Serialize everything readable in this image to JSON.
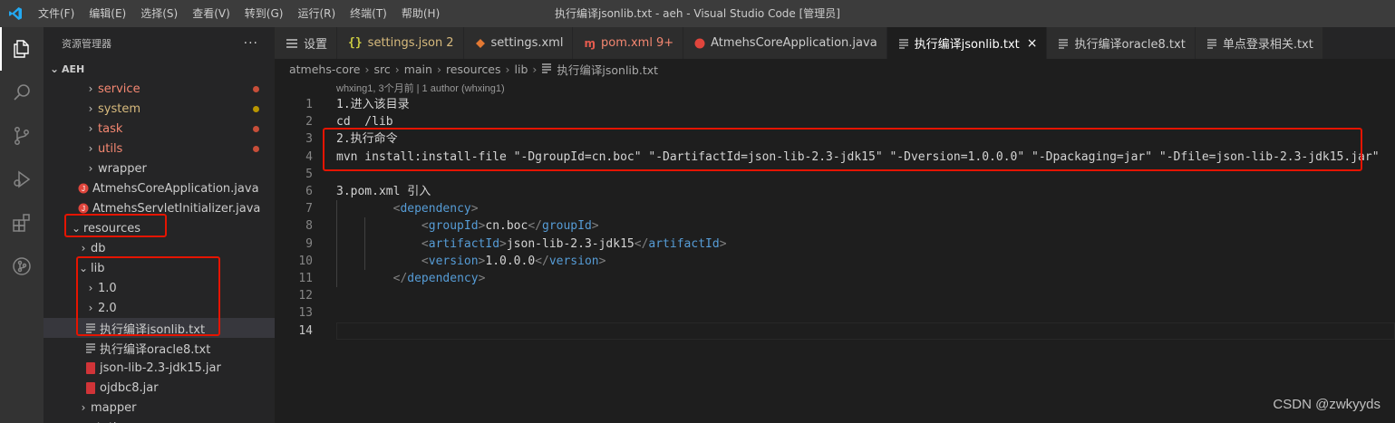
{
  "window": {
    "title": "执行编译jsonlib.txt - aeh - Visual Studio Code [管理员]",
    "menu": [
      "文件(F)",
      "编辑(E)",
      "选择(S)",
      "查看(V)",
      "转到(G)",
      "运行(R)",
      "终端(T)",
      "帮助(H)"
    ],
    "app_icon": "vscode-logo-icon"
  },
  "activity_bar": [
    "files-icon",
    "search-icon",
    "source-control-icon",
    "run-debug-icon",
    "extensions-icon",
    "git-graph-icon"
  ],
  "sidebar": {
    "title": "资源管理器",
    "more": "···",
    "root": "AEH",
    "items": [
      {
        "label": "service",
        "color": "#f48771",
        "dot": "#c74e39"
      },
      {
        "label": "system",
        "color": "#d7ba7d",
        "dot": "#b89500"
      },
      {
        "label": "task",
        "color": "#f48771",
        "dot": "#c74e39"
      },
      {
        "label": "utils",
        "color": "#f48771",
        "dot": "#c74e39"
      },
      {
        "label": "wrapper",
        "color": "#cccccc"
      },
      {
        "label": "AtmehsCoreApplication.java",
        "color": "#cccccc"
      },
      {
        "label": "AtmehsServletInitializer.java",
        "color": "#cccccc"
      },
      {
        "label": "resources",
        "color": "#cccccc"
      },
      {
        "label": "db",
        "color": "#cccccc"
      },
      {
        "label": "lib",
        "color": "#cccccc"
      },
      {
        "label": "1.0",
        "color": "#cccccc"
      },
      {
        "label": "2.0",
        "color": "#cccccc"
      },
      {
        "label": "执行编译jsonlib.txt",
        "color": "#cccccc"
      },
      {
        "label": "执行编译oracle8.txt",
        "color": "#cccccc"
      },
      {
        "label": "json-lib-2.3-jdk15.jar",
        "color": "#cccccc"
      },
      {
        "label": "ojdbc8.jar",
        "color": "#cccccc"
      },
      {
        "label": "mapper",
        "color": "#cccccc"
      },
      {
        "label": "static",
        "color": "#cccccc"
      }
    ]
  },
  "tabs": [
    {
      "label": "设置",
      "icon": "settings-icon",
      "color": "#cccccc"
    },
    {
      "label": "settings.json",
      "badge": "2",
      "icon": "json-braces-icon",
      "color": "#d7ba7d"
    },
    {
      "label": "settings.xml",
      "icon": "xml-icon",
      "color": "#cccccc"
    },
    {
      "label": "pom.xml",
      "badge": "9+",
      "icon": "maven-icon",
      "color": "#f48771"
    },
    {
      "label": "AtmehsCoreApplication.java",
      "icon": "java-icon",
      "color": "#cccccc"
    },
    {
      "label": "执行编译jsonlib.txt",
      "icon": "text-file-icon",
      "color": "#ffffff",
      "close": "×"
    },
    {
      "label": "执行编译oracle8.txt",
      "icon": "text-file-icon",
      "color": "#cccccc"
    },
    {
      "label": "单点登录相关.txt",
      "icon": "text-file-icon",
      "color": "#cccccc"
    }
  ],
  "breadcrumb": [
    "atmehs-core",
    "src",
    "main",
    "resources",
    "lib",
    "执行编译jsonlib.txt"
  ],
  "codelens": "whxing1, 3个月前 | 1 author (whxing1)",
  "editor_lines": [
    {
      "n": "1",
      "text": "1.进入该目录"
    },
    {
      "n": "2",
      "text": "cd  /lib"
    },
    {
      "n": "3",
      "text": "2.执行命令"
    },
    {
      "n": "4",
      "text": "mvn install:install-file \"-DgroupId=cn.boc\" \"-DartifactId=json-lib-2.3-jdk15\" \"-Dversion=1.0.0.0\" \"-Dpackaging=jar\" \"-Dfile=json-lib-2.3-jdk15.jar\""
    },
    {
      "n": "5",
      "text": ""
    },
    {
      "n": "6",
      "text": "3.pom.xml 引入"
    },
    {
      "n": "7",
      "indent": "        ",
      "tag": "dependency",
      "close": false
    },
    {
      "n": "8",
      "indent": "            ",
      "tag": "groupId",
      "value": "cn.boc"
    },
    {
      "n": "9",
      "indent": "            ",
      "tag": "artifactId",
      "value": "json-lib-2.3-jdk15"
    },
    {
      "n": "10",
      "indent": "            ",
      "tag": "version",
      "value": "1.0.0.0"
    },
    {
      "n": "11",
      "indent": "        ",
      "tag": "dependency",
      "close": true
    },
    {
      "n": "12",
      "text": ""
    },
    {
      "n": "13",
      "text": ""
    },
    {
      "n": "14",
      "text": ""
    }
  ],
  "watermark": "CSDN @zwkyyds"
}
